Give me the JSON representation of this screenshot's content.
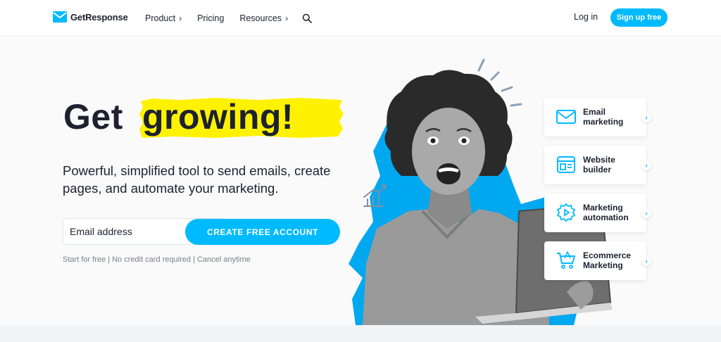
{
  "colors": {
    "accent": "#00baff",
    "highlight": "#fff200",
    "text": "#1d2130"
  },
  "header": {
    "brand": "GetResponse",
    "nav": [
      {
        "label": "Product",
        "icon": "chevron-right-icon"
      },
      {
        "label": "Pricing"
      },
      {
        "label": "Resources",
        "icon": "chevron-right-icon"
      }
    ],
    "search_icon": "search-icon",
    "login": "Log in",
    "signup": "Sign up free"
  },
  "hero": {
    "headline_part1": "Get",
    "headline_part2": "growing!",
    "subtitle": "Powerful, simplified tool to send emails, create pages, and automate your marketing.",
    "email_placeholder": "Email address",
    "cta": "CREATE FREE ACCOUNT",
    "fineprint": "Start for free | No credit card required | Cancel anytime"
  },
  "features": [
    {
      "label": "Email marketing",
      "icon": "envelope-icon"
    },
    {
      "label": "Website builder",
      "icon": "website-icon"
    },
    {
      "label": "Marketing automation",
      "icon": "automation-gear-icon"
    },
    {
      "label": "Ecommerce Marketing",
      "icon": "shopping-cart-icon"
    }
  ]
}
